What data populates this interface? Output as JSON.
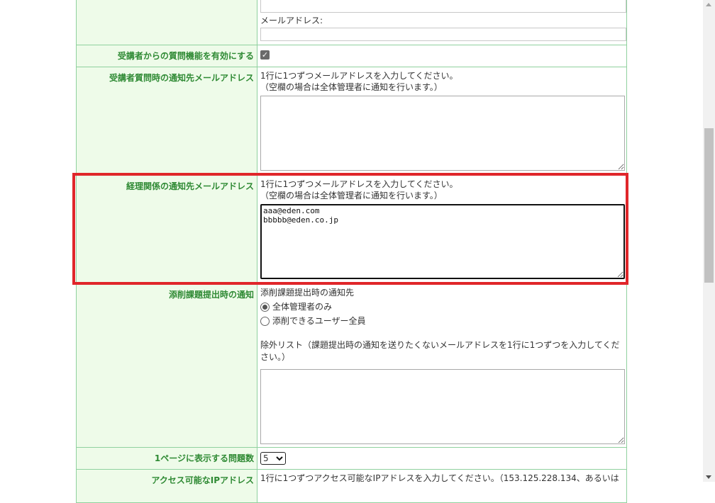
{
  "email_block": {
    "label": "メールアドレス:",
    "value": ""
  },
  "question_enable": {
    "label": "受講者からの質問機能を有効にする",
    "checked": true,
    "check_glyph": "✓"
  },
  "question_notify": {
    "label": "受講者質問時の通知先メールアドレス",
    "hint1": "1行に1つずつメールアドレスを入力してください。",
    "hint2": "（空欄の場合は全体管理者に通知を行います。）",
    "value": ""
  },
  "accounting_notify": {
    "label": "経理関係の通知先メールアドレス",
    "hint1": "1行に1つずつメールアドレスを入力してください。",
    "hint2": "（空欄の場合は全体管理者に通知を行います。）",
    "value": "aaa@eden.com\nbbbbb@eden.co.jp"
  },
  "correction_notify": {
    "label": "添削課題提出時の通知",
    "subheading": "添削課題提出時の通知先",
    "options": [
      {
        "label": "全体管理者のみ",
        "checked": true
      },
      {
        "label": "添削できるユーザー全員",
        "checked": false
      }
    ],
    "exclusion_hint": "除外リスト（課題提出時の通知を送りたくないメールアドレスを1行に1つずつを入力してください。）",
    "value": ""
  },
  "questions_per_page": {
    "label": "1ページに表示する問題数",
    "selected": "5"
  },
  "ip_access": {
    "label": "アクセス可能なIPアドレス",
    "hint": "1行に1つずつアクセス可能なIPアドレスを入力してください。（153.125.228.134、あるいは"
  },
  "colors": {
    "label_text": "#2f8a34",
    "label_bg": "#eefbe9",
    "border": "#8fd19e",
    "highlight": "#e0262a"
  }
}
